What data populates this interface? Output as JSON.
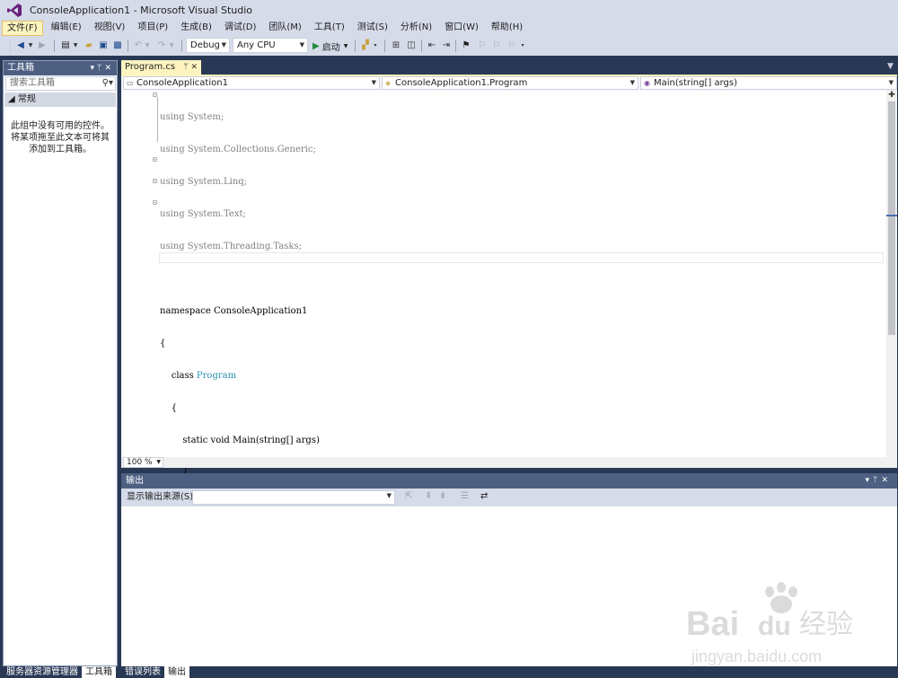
{
  "window": {
    "title": "ConsoleApplication1 - Microsoft Visual Studio"
  },
  "menu": [
    "文件(F)",
    "编辑(E)",
    "视图(V)",
    "项目(P)",
    "生成(B)",
    "调试(D)",
    "团队(M)",
    "工具(T)",
    "测试(S)",
    "分析(N)",
    "窗口(W)",
    "帮助(H)"
  ],
  "toolbar": {
    "config": "Debug",
    "platform": "Any CPU",
    "start_label": "启动"
  },
  "toolbox": {
    "title": "工具箱",
    "search_placeholder": "搜索工具箱",
    "category": "◢ 常规",
    "empty_text_1": "此组中没有可用的控件。",
    "empty_text_2": "将某项拖至此文本可将其",
    "empty_text_3": "添加到工具箱。"
  },
  "left_tabs": [
    "服务器资源管理器",
    "工具箱"
  ],
  "doc_tab": {
    "label": "Program.cs"
  },
  "navbar": {
    "project": "ConsoleApplication1",
    "type": "ConsoleApplication1.Program",
    "member": "Main(string[] args)"
  },
  "code": {
    "l1": "using System;",
    "l2": "using System.Collections.Generic;",
    "l3": "using System.Linq;",
    "l4": "using System.Text;",
    "l5": "using System.Threading.Tasks;",
    "l7a": "namespace ConsoleApplication1",
    "l8": "{",
    "l9a": "    class ",
    "l9b": "Program",
    "l10": "    {",
    "l11": "        static void Main(string[] args)",
    "l12": "        {",
    "l13": "        }",
    "l14": "    }",
    "l15": "}"
  },
  "zoom": "100 %",
  "output": {
    "title": "输出",
    "source_label": "显示输出来源(S):"
  },
  "bottom_tabs": [
    "错误列表",
    "输出"
  ],
  "watermark": {
    "brand": "Bai",
    "brand2": "du",
    "cn": "经验",
    "url": "jingyan.baidu.com"
  }
}
